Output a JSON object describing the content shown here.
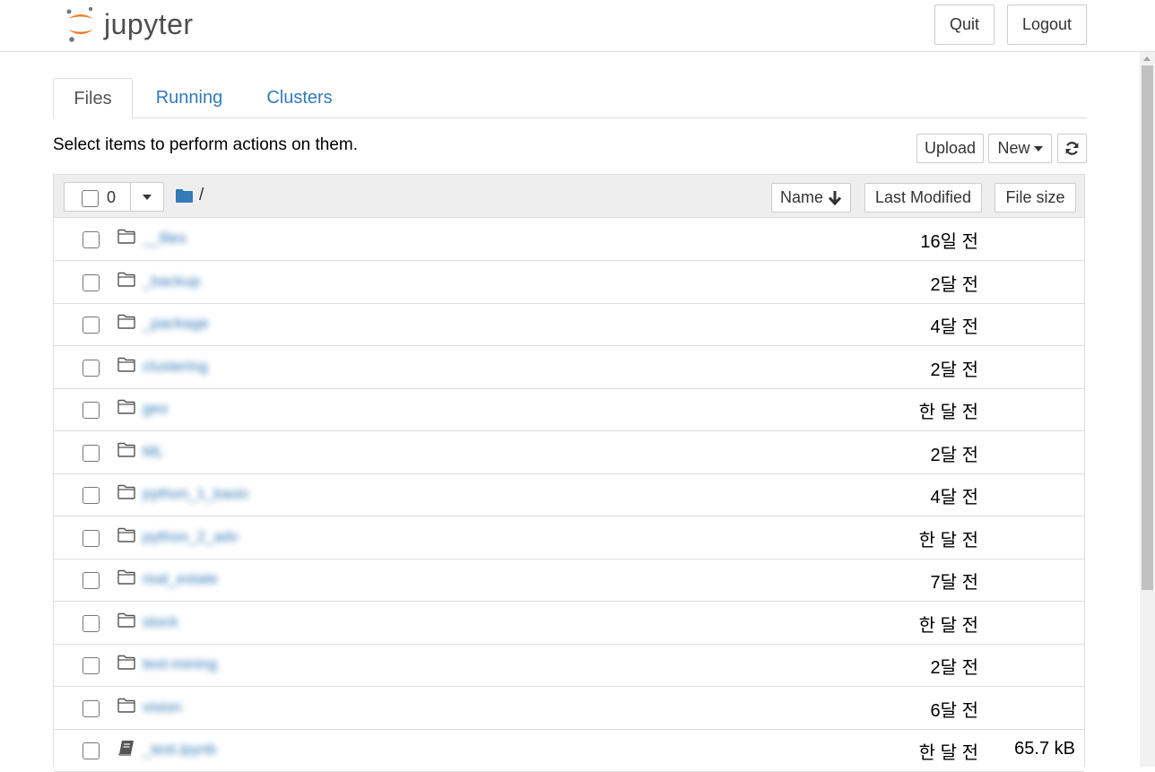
{
  "header": {
    "logo_text": "jupyter",
    "quit_label": "Quit",
    "logout_label": "Logout"
  },
  "tabs": [
    {
      "label": "Files",
      "active": true
    },
    {
      "label": "Running",
      "active": false
    },
    {
      "label": "Clusters",
      "active": false
    }
  ],
  "toolbar": {
    "instructions": "Select items to perform actions on them.",
    "upload_label": "Upload",
    "new_label": "New",
    "refresh_icon": "refresh-icon"
  },
  "list_header": {
    "selected_count": "0",
    "breadcrumb_root": "/",
    "sort_name_label": "Name",
    "sort_modified_label": "Last Modified",
    "sort_size_label": "File size"
  },
  "rows": [
    {
      "type": "folder",
      "name": "__files",
      "modified": "16일 전",
      "size": ""
    },
    {
      "type": "folder",
      "name": "_backup",
      "modified": "2달 전",
      "size": ""
    },
    {
      "type": "folder",
      "name": "_package",
      "modified": "4달 전",
      "size": ""
    },
    {
      "type": "folder",
      "name": "clustering",
      "modified": "2달 전",
      "size": ""
    },
    {
      "type": "folder",
      "name": "geo",
      "modified": "한 달 전",
      "size": ""
    },
    {
      "type": "folder",
      "name": "ML",
      "modified": "2달 전",
      "size": ""
    },
    {
      "type": "folder",
      "name": "python_1_basic",
      "modified": "4달 전",
      "size": ""
    },
    {
      "type": "folder",
      "name": "python_2_adv",
      "modified": "한 달 전",
      "size": ""
    },
    {
      "type": "folder",
      "name": "real_estate",
      "modified": "7달 전",
      "size": ""
    },
    {
      "type": "folder",
      "name": "stock",
      "modified": "한 달 전",
      "size": ""
    },
    {
      "type": "folder",
      "name": "text-mining",
      "modified": "2달 전",
      "size": ""
    },
    {
      "type": "folder",
      "name": "vision",
      "modified": "6달 전",
      "size": ""
    },
    {
      "type": "notebook",
      "name": "_test.ipynb",
      "modified": "한 달 전",
      "size": "65.7 kB"
    }
  ],
  "colors": {
    "link": "#337ab7",
    "logo_orange": "#f37726",
    "header_bg": "#eeeeee"
  }
}
